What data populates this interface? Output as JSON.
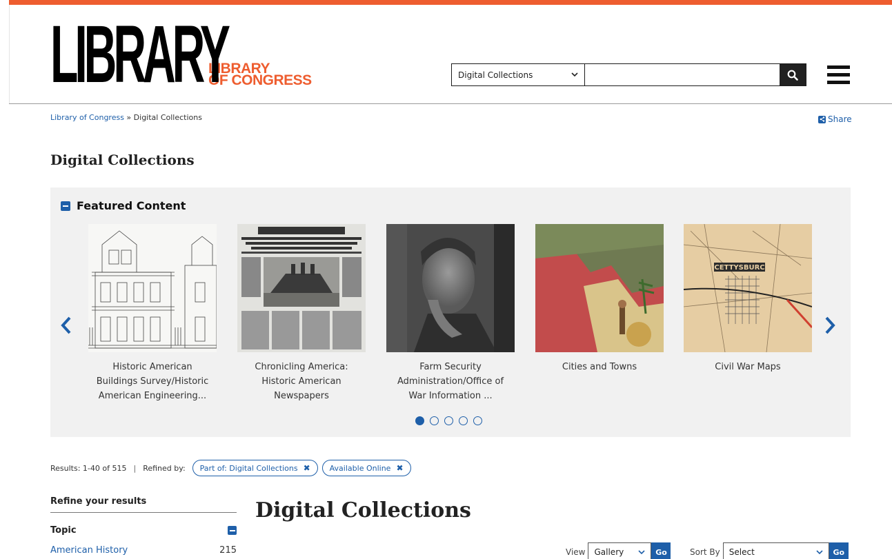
{
  "header": {
    "logo_big": "LIBRARY",
    "logo_small_line1": "LIBRARY",
    "logo_small_line2": "OF CONGRESS",
    "search_scope": "Digital Collections",
    "search_placeholder": "",
    "menu_icon": "hamburger-icon"
  },
  "breadcrumb": {
    "home": "Library of Congress",
    "sep": " » ",
    "current": "Digital Collections"
  },
  "share_label": "Share",
  "page_title": "Digital Collections",
  "featured": {
    "heading": "Featured Content",
    "slides": [
      {
        "caption": "Historic American Buildings Survey/Historic American Engineering..."
      },
      {
        "caption": "Chronicling America: Historic American Newspapers"
      },
      {
        "caption": "Farm Security Administration/Office of War Information ..."
      },
      {
        "caption": "Cities and Towns"
      },
      {
        "caption": "Civil War Maps"
      }
    ],
    "dots_total": 5,
    "dots_active": 1
  },
  "results": {
    "summary": "Results: 1-40 of 515",
    "sep": "|",
    "refined_label": "Refined by:",
    "filters": [
      "Part of: Digital Collections",
      "Available Online"
    ]
  },
  "sidebar": {
    "title": "Refine your results",
    "topic_label": "Topic",
    "facets": [
      {
        "label": "American History",
        "count": "215"
      }
    ]
  },
  "main": {
    "title": "Digital Collections",
    "view_label": "View",
    "view_value": "Gallery",
    "sort_label": "Sort By",
    "sort_value": "Select",
    "go_label": "Go"
  },
  "colors": {
    "accent": "#ee5d2f",
    "link": "#1e5fa9"
  }
}
